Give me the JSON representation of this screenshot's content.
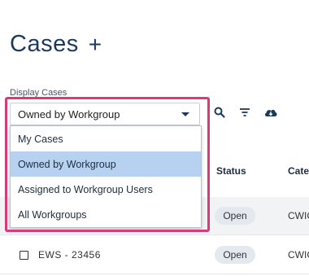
{
  "header": {
    "title": "Cases",
    "add_symbol": "+"
  },
  "filter": {
    "label": "Display Cases",
    "selected": "Owned by Workgroup",
    "options": [
      "My Cases",
      "Owned by Workgroup",
      "Assigned to Workgroup Users",
      "All Workgroups"
    ]
  },
  "toolbar": {
    "icons": [
      "search-icon",
      "filter-icon",
      "cloud-download-icon"
    ]
  },
  "table": {
    "columns": [
      "Status",
      "Cate"
    ],
    "rows": [
      {
        "id": "",
        "status": "Open",
        "category": "CWIC"
      },
      {
        "id": "EWS - 23456",
        "status": "Open",
        "category": "CWIC"
      }
    ]
  },
  "colors": {
    "highlight": "#d93a7a",
    "selected_option": "#b7d2f0",
    "title": "#1c3a5e"
  }
}
